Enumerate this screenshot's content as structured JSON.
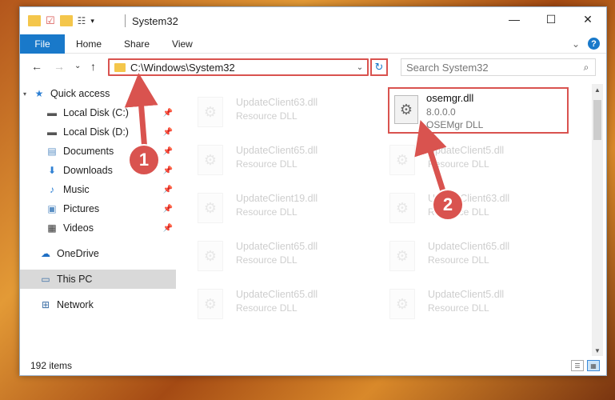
{
  "window": {
    "title": "System32",
    "controls": {
      "minimize": "—",
      "maximize": "☐",
      "close": "✕"
    }
  },
  "ribbon": {
    "tabs": [
      "File",
      "Home",
      "Share",
      "View"
    ],
    "expand": "⌄",
    "help": "?"
  },
  "nav": {
    "back": "←",
    "forward": "→",
    "recent": "⌄",
    "up": "↑",
    "address": "C:\\Windows\\System32",
    "address_dropdown": "⌄",
    "refresh": "↻",
    "search_placeholder": "Search System32",
    "search_icon": "⌕"
  },
  "sidebar": {
    "items": [
      {
        "label": "Quick access",
        "icon": "star-icon",
        "glyph": "★",
        "color": "#2d7fd3",
        "pinned": false
      },
      {
        "label": "Local Disk (C:)",
        "icon": "drive-icon",
        "glyph": "▬",
        "color": "#555555",
        "pinned": true
      },
      {
        "label": "Local Disk (D:)",
        "icon": "drive-icon",
        "glyph": "▬",
        "color": "#555555",
        "pinned": true
      },
      {
        "label": "Documents",
        "icon": "document-icon",
        "glyph": "▤",
        "color": "#5a8fc4",
        "pinned": true
      },
      {
        "label": "Downloads",
        "icon": "download-icon",
        "glyph": "⬇",
        "color": "#2d7fd3",
        "pinned": true
      },
      {
        "label": "Music",
        "icon": "music-icon",
        "glyph": "♪",
        "color": "#2d7fd3",
        "pinned": true
      },
      {
        "label": "Pictures",
        "icon": "pictures-icon",
        "glyph": "▣",
        "color": "#5a8fc4",
        "pinned": true
      },
      {
        "label": "Videos",
        "icon": "videos-icon",
        "glyph": "▦",
        "color": "#333333",
        "pinned": true
      }
    ],
    "onedrive": {
      "label": "OneDrive",
      "icon": "cloud-icon",
      "glyph": "☁",
      "color": "#1f6fc4"
    },
    "thispc": {
      "label": "This PC",
      "icon": "computer-icon",
      "glyph": "▭",
      "color": "#3b6ea5"
    },
    "network": {
      "label": "Network",
      "icon": "network-icon",
      "glyph": "⊞",
      "color": "#3b6ea5"
    },
    "pin_glyph": "📌"
  },
  "files": [
    {
      "name": "UpdateClient63.dll",
      "desc": "Resource DLL"
    },
    {
      "name": "UpdateClient65.dll",
      "desc": "Resource DLL"
    },
    {
      "name": "UpdateClient5.dll",
      "desc": "Resource DLL"
    },
    {
      "name": "UpdateClient19.dll",
      "desc": "Resource DLL"
    },
    {
      "name": "UpdateClient63.dll",
      "desc": "Resource DLL"
    },
    {
      "name": "UpdateClient65.dll",
      "desc": "Resource DLL"
    },
    {
      "name": "UpdateClient65.dll",
      "desc": "Resource DLL"
    },
    {
      "name": "UpdateClient65.dll",
      "desc": "Resource DLL"
    },
    {
      "name": "UpdateClient5.dll",
      "desc": "Resource DLL"
    }
  ],
  "highlighted_file": {
    "name": "osemgr.dll",
    "version": "8.0.0.0",
    "desc": "OSEMgr DLL"
  },
  "status": {
    "count": "192 items"
  },
  "annotations": {
    "badge1": "1",
    "badge2": "2",
    "color": "#d9534f"
  }
}
